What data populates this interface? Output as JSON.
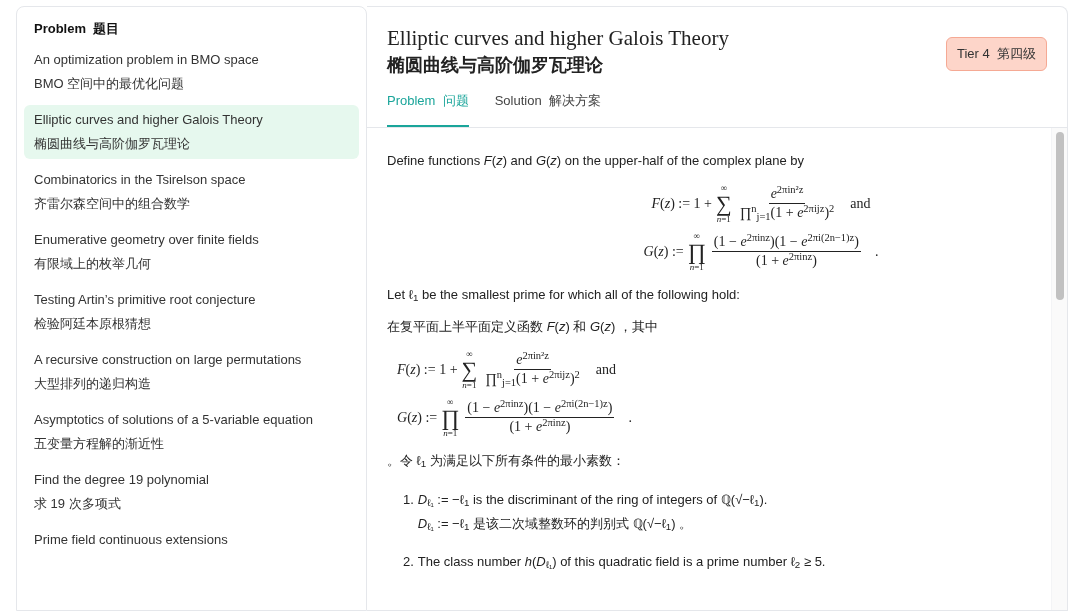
{
  "sidebar": {
    "heading": "Problem  题目",
    "items": [
      {
        "title": "An optimization problem in BMO space",
        "subtitle": "BMO 空间中的最优化问题",
        "selected": false
      },
      {
        "title": "Elliptic curves and higher Galois Theory",
        "subtitle": "椭圆曲线与高阶伽罗瓦理论",
        "selected": true
      },
      {
        "title": "Combinatorics in the Tsirelson space",
        "subtitle": "齐雷尔森空间中的组合数学",
        "selected": false
      },
      {
        "title": "Enumerative geometry over finite fields",
        "subtitle": "有限域上的枚举几何",
        "selected": false
      },
      {
        "title": "Testing Artin’s primitive root conjecture",
        "subtitle": "检验阿廷本原根猜想",
        "selected": false
      },
      {
        "title": "A recursive construction on large permutations",
        "subtitle": "大型排列的递归构造",
        "selected": false
      },
      {
        "title": "Asymptotics of solutions of a 5-variable equation",
        "subtitle": "五变量方程解的渐近性",
        "selected": false
      },
      {
        "title": "Find the degree 19 polynomial",
        "subtitle": "求 19 次多项式",
        "selected": false
      },
      {
        "title": "Prime field continuous extensions",
        "selected": false
      }
    ]
  },
  "header": {
    "title": "Elliptic curves and higher Galois Theory",
    "title_zh": "椭圆曲线与高阶伽罗瓦理论",
    "tier": "Tier 4  第四级",
    "tabs": [
      {
        "label": "Problem  问题",
        "selected": true
      },
      {
        "label": "Solution  解决方案",
        "selected": false
      }
    ]
  },
  "content": [
    {
      "kind": "text",
      "text": "Define functions *F*(*z*) and *G*(*z*) on the upper-half of the complex plane by"
    },
    {
      "kind": "display",
      "centered": true,
      "equations": [
        {
          "lhs": "*F*(*z*) := 1 +",
          "operator": "∑",
          "upper": "∞",
          "lower": "*n*=1",
          "numerator": "*e*$^{2πin²z}$",
          "denominator": "∏$^{n}$$_{j=1}$(1 + *e*$^{2πijz}$)$^{2}$",
          "suffix": "and"
        },
        {
          "lhs": "*G*(*z*) :=",
          "operator": "∏",
          "upper": "∞",
          "lower": "*n*=1",
          "numerator": "(1 − *e*$^{2πinz}$)(1 − *e*$^{2πi(2n−1)z}$)",
          "denominator": "(1 + *e*$^{2πinz}$)",
          "suffix": "."
        }
      ]
    },
    {
      "kind": "text",
      "text": "Let ℓ$_{1}$ be the smallest prime for which all of the following hold:"
    },
    {
      "kind": "text",
      "text": "在复平面上半平面定义函数 *F*(*z*) 和 *G*(*z*) ，其中"
    },
    {
      "kind": "display",
      "centered": false,
      "equations": [
        {
          "lhs": "*F*(*z*) := 1 +",
          "operator": "∑",
          "upper": "∞",
          "lower": "*n*=1",
          "numerator": "*e*$^{2πin²z}$",
          "denominator": "∏$^{n}$$_{j=1}$(1 + *e*$^{2πijz}$)$^{2}$",
          "suffix": "and"
        },
        {
          "lhs": "*G*(*z*) :=",
          "operator": "∏",
          "upper": "∞",
          "lower": "*n*=1",
          "numerator": "(1 − *e*$^{2πinz}$)(1 − *e*$^{2πi(2n−1)z}$)",
          "denominator": "(1 + *e*$^{2πinz}$)",
          "suffix": "."
        }
      ]
    },
    {
      "kind": "text",
      "text": "。令 ℓ$_{1}$ 为满足以下所有条件的最小素数："
    },
    {
      "kind": "item",
      "number": "1.",
      "lines": [
        "*D*$_{ℓ₁}$ := −ℓ$_{1}$ is the discriminant of the ring of integers of ℚ(√−ℓ$_{1}$).",
        "*D*$_{ℓ₁}$ := −ℓ$_{1}$ 是该二次域整数环的判别式 ℚ(√−ℓ$_{1}$) 。"
      ]
    },
    {
      "kind": "item",
      "number": "2.",
      "lines": [
        "The class number *h*(*D*$_{ℓ₁}$) of this quadratic field is a prime number ℓ$_{2}$ ≥ 5."
      ]
    }
  ]
}
